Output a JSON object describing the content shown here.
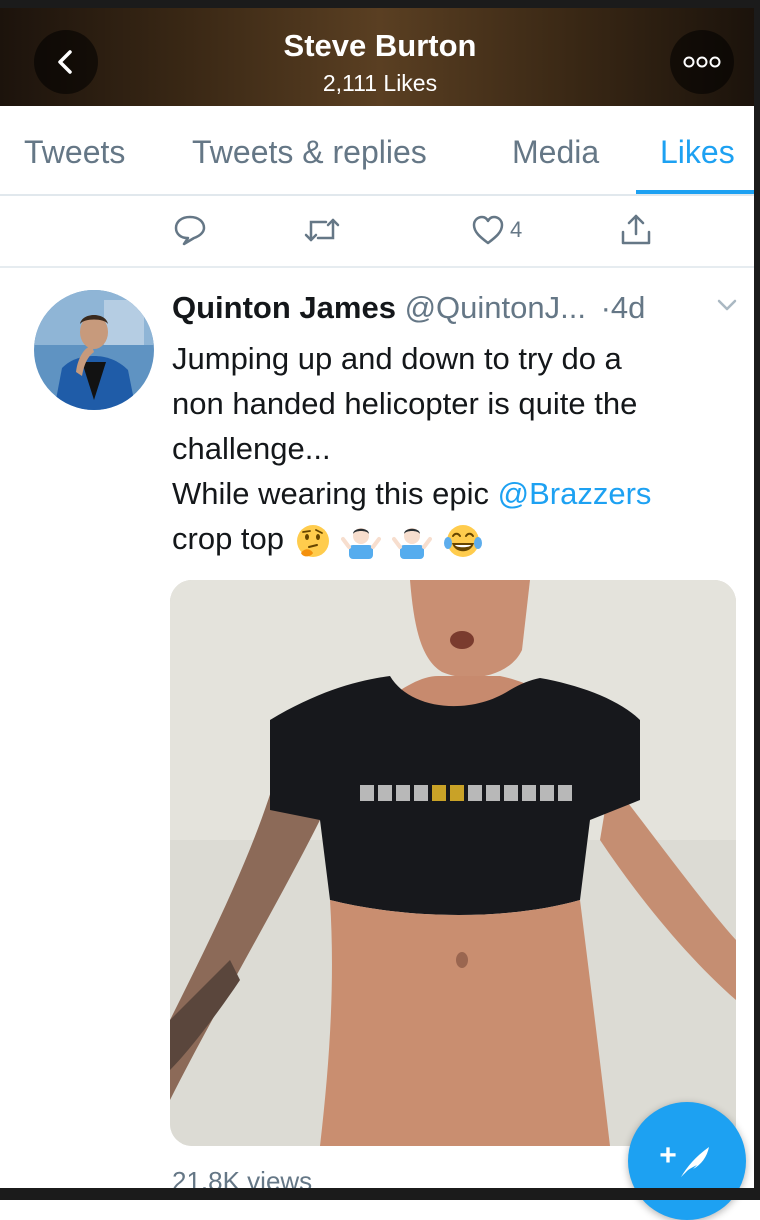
{
  "header": {
    "title": "Steve Burton",
    "subtitle": "2,111 Likes",
    "back_icon": "chevron-left-icon",
    "more_icon": "more-dots-icon"
  },
  "tabs": [
    {
      "label": "Tweets",
      "active": false
    },
    {
      "label": "Tweets & replies",
      "active": false
    },
    {
      "label": "Media",
      "active": false
    },
    {
      "label": "Likes",
      "active": true
    }
  ],
  "action_row": {
    "reply_icon": "reply-icon",
    "retweet_icon": "retweet-icon",
    "like_icon": "heart-icon",
    "like_count": "4",
    "share_icon": "share-icon"
  },
  "tweet": {
    "name": "Quinton James",
    "handle": "@QuintonJ...",
    "time": "·4d",
    "text_lines": [
      "Jumping up and down to try do a",
      "non handed helicopter is quite the",
      "challenge..."
    ],
    "text_line4_prefix": "While wearing this epic ",
    "mention": "@Brazzers",
    "text_line5": "crop top",
    "emojis": [
      "thinking-face-emoji",
      "man-shrugging-emoji",
      "man-shrugging-emoji",
      "tears-of-joy-emoji"
    ],
    "views": "21.8K views"
  },
  "compose_button": {
    "icon": "compose-feather-icon",
    "label": "+"
  },
  "colors": {
    "accent": "#1da1f2",
    "secondary_text": "#657786",
    "primary_text": "#14171a"
  }
}
